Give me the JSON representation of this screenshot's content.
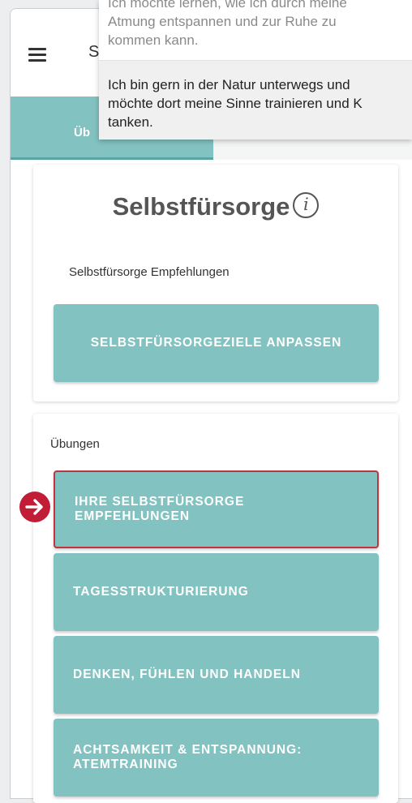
{
  "app": {
    "title_partial": "S",
    "tab_active_partial": "Üb"
  },
  "popup": {
    "item1_lines": [
      "Ich möchte lernen, wie ich durch meine",
      "Atmung entspannen und zur Ruhe zu",
      "kommen kann."
    ],
    "item2_lines": [
      "Ich bin gern in der Natur unterwegs und",
      "möchte dort meine Sinne trainieren und K",
      "tanken."
    ]
  },
  "selfcare": {
    "title": "Selbstfürsorge",
    "info_glyph": "i",
    "subtitle": "Selbstfürsorge Empfehlungen",
    "adjust_button": "SELBSTFÜRSORGEZIELE ANPASSEN"
  },
  "exercises": {
    "heading": "Übungen",
    "items": [
      {
        "lines": [
          "IHRE SELBSTFÜRSORGE",
          "EMPFEHLUNGEN"
        ]
      },
      {
        "lines": [
          "TAGESSTRUKTURIERUNG"
        ]
      },
      {
        "lines": [
          "DENKEN, FÜHLEN UND HANDELN"
        ]
      },
      {
        "lines": [
          "ACHTSAMKEIT & ENTSPANNUNG:",
          "ATEMTRAINING"
        ]
      }
    ]
  },
  "colors": {
    "teal": "#82c2c0",
    "highlight_border": "#c0343f",
    "arrow": "#c21d36"
  },
  "icons": {
    "menu": "hamburger-menu-icon",
    "info": "info-circle-icon",
    "pointer": "arrow-right-circle-icon"
  }
}
